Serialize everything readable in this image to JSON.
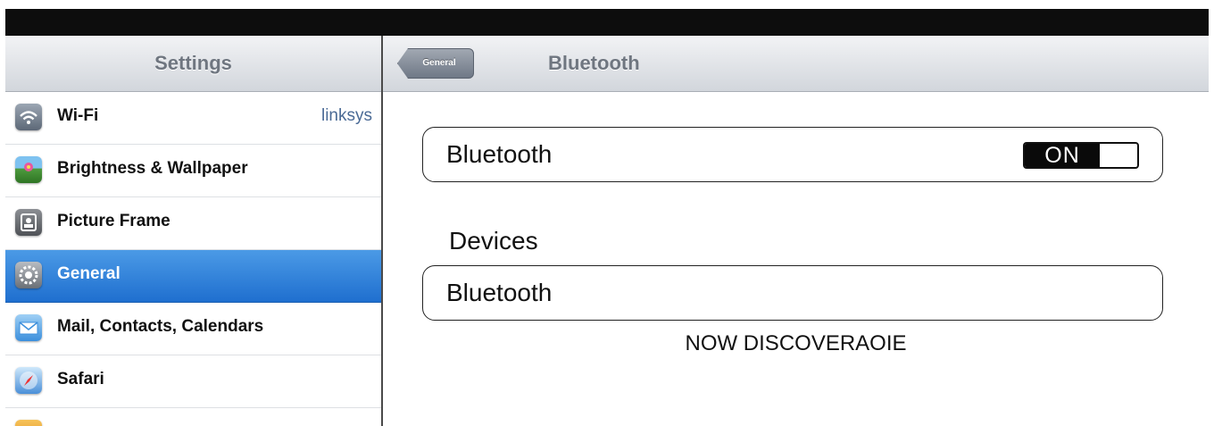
{
  "master": {
    "title": "Settings",
    "items": [
      {
        "label": "Wi-Fi",
        "value": "linksys",
        "icon": "wifi-icon"
      },
      {
        "label": "Brightness & Wallpaper",
        "icon": "brightness-wallpaper-icon"
      },
      {
        "label": "Picture Frame",
        "icon": "picture-frame-icon"
      },
      {
        "label": "General",
        "icon": "gear-icon",
        "selected": true
      },
      {
        "label": "Mail, Contacts, Calendars",
        "icon": "mail-icon"
      },
      {
        "label": "Safari",
        "icon": "safari-compass-icon"
      }
    ]
  },
  "detail": {
    "back_label": "General",
    "title": "Bluetooth",
    "bluetooth_row": {
      "label": "Bluetooth",
      "toggle": "ON"
    },
    "devices_header": "Devices",
    "device_row": {
      "label": "Bluetooth"
    },
    "footer": "NOW DISCOVERAOIE"
  },
  "colors": {
    "selected_row": "#2a7fdc",
    "status_bar": "#0d0d0d",
    "toggle_on": "#0a0a0a"
  }
}
